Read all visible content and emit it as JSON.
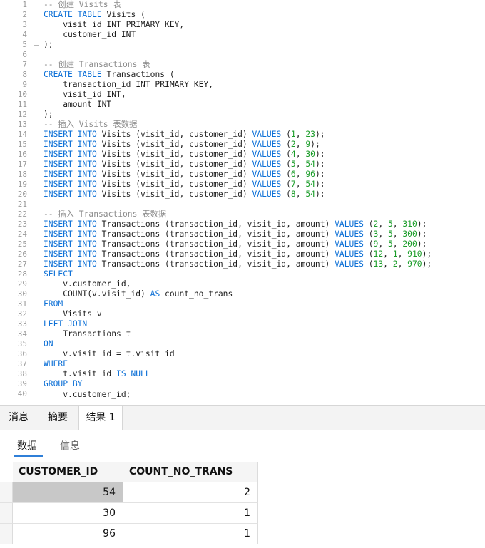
{
  "editor": {
    "lines": [
      {
        "n": "1",
        "s": [
          [
            "cm",
            "-- 创建 Visits 表"
          ]
        ]
      },
      {
        "n": "2",
        "s": [
          [
            "kw",
            "CREATE"
          ],
          [
            "t",
            " "
          ],
          [
            "kw",
            "TABLE"
          ],
          [
            "t",
            " Visits ("
          ]
        ]
      },
      {
        "n": "3",
        "s": [
          [
            "t",
            "    visit_id INT PRIMARY KEY,"
          ]
        ]
      },
      {
        "n": "4",
        "s": [
          [
            "t",
            "    customer_id INT"
          ]
        ]
      },
      {
        "n": "5",
        "s": [
          [
            "t",
            ");"
          ]
        ]
      },
      {
        "n": "6",
        "s": []
      },
      {
        "n": "7",
        "s": [
          [
            "cm",
            "-- 创建 Transactions 表"
          ]
        ]
      },
      {
        "n": "8",
        "s": [
          [
            "kw",
            "CREATE"
          ],
          [
            "t",
            " "
          ],
          [
            "kw",
            "TABLE"
          ],
          [
            "t",
            " Transactions ("
          ]
        ]
      },
      {
        "n": "9",
        "s": [
          [
            "t",
            "    transaction_id INT PRIMARY KEY,"
          ]
        ]
      },
      {
        "n": "10",
        "s": [
          [
            "t",
            "    visit_id INT,"
          ]
        ]
      },
      {
        "n": "11",
        "s": [
          [
            "t",
            "    amount INT"
          ]
        ]
      },
      {
        "n": "12",
        "s": [
          [
            "t",
            ");"
          ]
        ]
      },
      {
        "n": "13",
        "s": [
          [
            "cm",
            "-- 插入 Visits 表数据"
          ]
        ]
      },
      {
        "n": "14",
        "s": [
          [
            "kw",
            "INSERT"
          ],
          [
            "t",
            " "
          ],
          [
            "kw",
            "INTO"
          ],
          [
            "t",
            " Visits (visit_id, customer_id) "
          ],
          [
            "kw",
            "VALUES"
          ],
          [
            "t",
            " ("
          ],
          [
            "nm",
            "1"
          ],
          [
            "t",
            ", "
          ],
          [
            "nm",
            "23"
          ],
          [
            "t",
            ");"
          ]
        ]
      },
      {
        "n": "15",
        "s": [
          [
            "kw",
            "INSERT"
          ],
          [
            "t",
            " "
          ],
          [
            "kw",
            "INTO"
          ],
          [
            "t",
            " Visits (visit_id, customer_id) "
          ],
          [
            "kw",
            "VALUES"
          ],
          [
            "t",
            " ("
          ],
          [
            "nm",
            "2"
          ],
          [
            "t",
            ", "
          ],
          [
            "nm",
            "9"
          ],
          [
            "t",
            ");"
          ]
        ]
      },
      {
        "n": "16",
        "s": [
          [
            "kw",
            "INSERT"
          ],
          [
            "t",
            " "
          ],
          [
            "kw",
            "INTO"
          ],
          [
            "t",
            " Visits (visit_id, customer_id) "
          ],
          [
            "kw",
            "VALUES"
          ],
          [
            "t",
            " ("
          ],
          [
            "nm",
            "4"
          ],
          [
            "t",
            ", "
          ],
          [
            "nm",
            "30"
          ],
          [
            "t",
            ");"
          ]
        ]
      },
      {
        "n": "17",
        "s": [
          [
            "kw",
            "INSERT"
          ],
          [
            "t",
            " "
          ],
          [
            "kw",
            "INTO"
          ],
          [
            "t",
            " Visits (visit_id, customer_id) "
          ],
          [
            "kw",
            "VALUES"
          ],
          [
            "t",
            " ("
          ],
          [
            "nm",
            "5"
          ],
          [
            "t",
            ", "
          ],
          [
            "nm",
            "54"
          ],
          [
            "t",
            ");"
          ]
        ]
      },
      {
        "n": "18",
        "s": [
          [
            "kw",
            "INSERT"
          ],
          [
            "t",
            " "
          ],
          [
            "kw",
            "INTO"
          ],
          [
            "t",
            " Visits (visit_id, customer_id) "
          ],
          [
            "kw",
            "VALUES"
          ],
          [
            "t",
            " ("
          ],
          [
            "nm",
            "6"
          ],
          [
            "t",
            ", "
          ],
          [
            "nm",
            "96"
          ],
          [
            "t",
            ");"
          ]
        ]
      },
      {
        "n": "19",
        "s": [
          [
            "kw",
            "INSERT"
          ],
          [
            "t",
            " "
          ],
          [
            "kw",
            "INTO"
          ],
          [
            "t",
            " Visits (visit_id, customer_id) "
          ],
          [
            "kw",
            "VALUES"
          ],
          [
            "t",
            " ("
          ],
          [
            "nm",
            "7"
          ],
          [
            "t",
            ", "
          ],
          [
            "nm",
            "54"
          ],
          [
            "t",
            ");"
          ]
        ]
      },
      {
        "n": "20",
        "s": [
          [
            "kw",
            "INSERT"
          ],
          [
            "t",
            " "
          ],
          [
            "kw",
            "INTO"
          ],
          [
            "t",
            " Visits (visit_id, customer_id) "
          ],
          [
            "kw",
            "VALUES"
          ],
          [
            "t",
            " ("
          ],
          [
            "nm",
            "8"
          ],
          [
            "t",
            ", "
          ],
          [
            "nm",
            "54"
          ],
          [
            "t",
            ");"
          ]
        ]
      },
      {
        "n": "21",
        "s": []
      },
      {
        "n": "22",
        "s": [
          [
            "cm",
            "-- 插入 Transactions 表数据"
          ]
        ]
      },
      {
        "n": "23",
        "s": [
          [
            "kw",
            "INSERT"
          ],
          [
            "t",
            " "
          ],
          [
            "kw",
            "INTO"
          ],
          [
            "t",
            " Transactions (transaction_id, visit_id, amount) "
          ],
          [
            "kw",
            "VALUES"
          ],
          [
            "t",
            " ("
          ],
          [
            "nm",
            "2"
          ],
          [
            "t",
            ", "
          ],
          [
            "nm",
            "5"
          ],
          [
            "t",
            ", "
          ],
          [
            "nm",
            "310"
          ],
          [
            "t",
            ");"
          ]
        ]
      },
      {
        "n": "24",
        "s": [
          [
            "kw",
            "INSERT"
          ],
          [
            "t",
            " "
          ],
          [
            "kw",
            "INTO"
          ],
          [
            "t",
            " Transactions (transaction_id, visit_id, amount) "
          ],
          [
            "kw",
            "VALUES"
          ],
          [
            "t",
            " ("
          ],
          [
            "nm",
            "3"
          ],
          [
            "t",
            ", "
          ],
          [
            "nm",
            "5"
          ],
          [
            "t",
            ", "
          ],
          [
            "nm",
            "300"
          ],
          [
            "t",
            ");"
          ]
        ]
      },
      {
        "n": "25",
        "s": [
          [
            "kw",
            "INSERT"
          ],
          [
            "t",
            " "
          ],
          [
            "kw",
            "INTO"
          ],
          [
            "t",
            " Transactions (transaction_id, visit_id, amount) "
          ],
          [
            "kw",
            "VALUES"
          ],
          [
            "t",
            " ("
          ],
          [
            "nm",
            "9"
          ],
          [
            "t",
            ", "
          ],
          [
            "nm",
            "5"
          ],
          [
            "t",
            ", "
          ],
          [
            "nm",
            "200"
          ],
          [
            "t",
            ");"
          ]
        ]
      },
      {
        "n": "26",
        "s": [
          [
            "kw",
            "INSERT"
          ],
          [
            "t",
            " "
          ],
          [
            "kw",
            "INTO"
          ],
          [
            "t",
            " Transactions (transaction_id, visit_id, amount) "
          ],
          [
            "kw",
            "VALUES"
          ],
          [
            "t",
            " ("
          ],
          [
            "nm",
            "12"
          ],
          [
            "t",
            ", "
          ],
          [
            "nm",
            "1"
          ],
          [
            "t",
            ", "
          ],
          [
            "nm",
            "910"
          ],
          [
            "t",
            ");"
          ]
        ]
      },
      {
        "n": "27",
        "s": [
          [
            "kw",
            "INSERT"
          ],
          [
            "t",
            " "
          ],
          [
            "kw",
            "INTO"
          ],
          [
            "t",
            " Transactions (transaction_id, visit_id, amount) "
          ],
          [
            "kw",
            "VALUES"
          ],
          [
            "t",
            " ("
          ],
          [
            "nm",
            "13"
          ],
          [
            "t",
            ", "
          ],
          [
            "nm",
            "2"
          ],
          [
            "t",
            ", "
          ],
          [
            "nm",
            "970"
          ],
          [
            "t",
            ");"
          ]
        ]
      },
      {
        "n": "28",
        "s": [
          [
            "kw",
            "SELECT"
          ]
        ]
      },
      {
        "n": "29",
        "s": [
          [
            "t",
            "    v.customer_id,"
          ]
        ]
      },
      {
        "n": "30",
        "s": [
          [
            "t",
            "    COUNT(v.visit_id) "
          ],
          [
            "kw",
            "AS"
          ],
          [
            "t",
            " count_no_trans"
          ]
        ]
      },
      {
        "n": "31",
        "s": [
          [
            "kw",
            "FROM"
          ]
        ]
      },
      {
        "n": "32",
        "s": [
          [
            "t",
            "    Visits v"
          ]
        ]
      },
      {
        "n": "33",
        "s": [
          [
            "kw",
            "LEFT"
          ],
          [
            "t",
            " "
          ],
          [
            "kw",
            "JOIN"
          ]
        ]
      },
      {
        "n": "34",
        "s": [
          [
            "t",
            "    Transactions t"
          ]
        ]
      },
      {
        "n": "35",
        "s": [
          [
            "kw",
            "ON"
          ]
        ]
      },
      {
        "n": "36",
        "s": [
          [
            "t",
            "    v.visit_id = t.visit_id"
          ]
        ]
      },
      {
        "n": "37",
        "s": [
          [
            "kw",
            "WHERE"
          ]
        ]
      },
      {
        "n": "38",
        "s": [
          [
            "t",
            "    t.visit_id "
          ],
          [
            "kw",
            "IS"
          ],
          [
            "t",
            " "
          ],
          [
            "kw",
            "NULL"
          ]
        ]
      },
      {
        "n": "39",
        "s": [
          [
            "kw",
            "GROUP"
          ],
          [
            "t",
            " "
          ],
          [
            "kw",
            "BY"
          ]
        ]
      },
      {
        "n": "40",
        "s": [
          [
            "t",
            "    v.customer_id;"
          ]
        ]
      }
    ]
  },
  "panel_tabs": [
    "消息",
    "摘要",
    "结果 1"
  ],
  "active_panel_tab": "结果 1",
  "sub_tabs": [
    "数据",
    "信息"
  ],
  "active_sub_tab": "数据",
  "results": {
    "columns": [
      "CUSTOMER_ID",
      "COUNT_NO_TRANS"
    ],
    "rows": [
      [
        "54",
        "2"
      ],
      [
        "30",
        "1"
      ],
      [
        "96",
        "1"
      ]
    ],
    "selected_row": 0
  },
  "colors": {
    "keyword": "#0b6fd6",
    "comment": "#8a8a8a",
    "number": "#1a9c28",
    "tab_underline": "#2f7fd8"
  }
}
